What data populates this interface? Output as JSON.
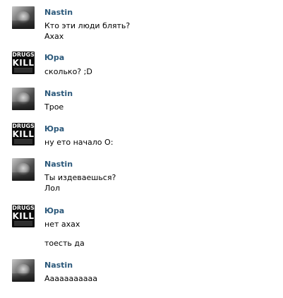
{
  "messages": [
    {
      "author": "Nastin",
      "avatar": "photo-avatar",
      "lines": [
        "Кто эти люди блять?",
        "Ахах"
      ]
    },
    {
      "author": "Юра",
      "avatar": "drugs-kill-logo",
      "lines": [
        "сколько? ;D"
      ]
    },
    {
      "author": "Nastin",
      "avatar": "photo-avatar",
      "lines": [
        "Трое"
      ]
    },
    {
      "author": "Юра",
      "avatar": "drugs-kill-logo",
      "lines": [
        "ну ето начало О:"
      ]
    },
    {
      "author": "Nastin",
      "avatar": "photo-avatar",
      "lines": [
        "Ты издеваешься?",
        "Лол"
      ]
    },
    {
      "author": "Юра",
      "avatar": "drugs-kill-logo",
      "lines": [
        "нет ахах",
        "тоесть да"
      ]
    },
    {
      "author": "Nastin",
      "avatar": "photo-avatar",
      "lines": [
        "Ааааааааааа"
      ]
    }
  ],
  "logo_text": {
    "top": "DRUGS",
    "bottom": "KILL"
  },
  "colors": {
    "author": "#2b587a",
    "text": "#000000",
    "background": "#ffffff"
  }
}
